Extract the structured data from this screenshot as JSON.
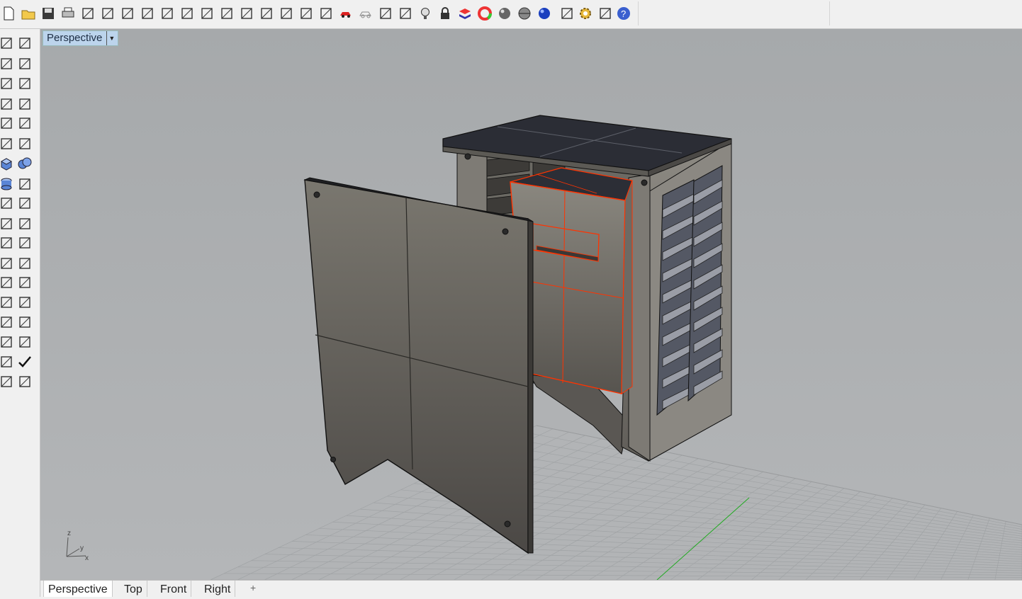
{
  "toolbar": {
    "icons": [
      "new-file-icon",
      "open-folder-icon",
      "save-icon",
      "print-icon",
      "import-icon",
      "cut-icon",
      "copy-icon",
      "paste-icon",
      "undo-icon",
      "pan-hand-icon",
      "rotate-view-icon",
      "zoom-icon",
      "zoom-window-icon",
      "zoom-extents-icon",
      "zoom-selected-icon",
      "rotate-camera-icon",
      "four-viewports-icon",
      "car-shade-icon",
      "car-wireframe-icon",
      "circle-target-icon",
      "snap-grid-icon",
      "light-bulb-icon",
      "lock-icon",
      "layer-icon",
      "color-wheel-icon",
      "sphere-gray-icon",
      "sphere-rendered-icon",
      "sphere-blue-icon",
      "pen-icon",
      "settings-gear-icon",
      "dimension-icon",
      "help-icon"
    ]
  },
  "sidebar": {
    "icons": [
      "select-arrow-icon",
      "point-icon",
      "polyline-icon",
      "curve-icon",
      "circle-icon",
      "ellipse-icon",
      "arc-icon",
      "rectangle-icon",
      "polygon-icon",
      "fillet-curve-icon",
      "surface-icon",
      "surface-edit-icon",
      "box-icon",
      "boolean-spheres-icon",
      "cylinder-icon",
      "mesh-plane-icon",
      "explode-gear-icon",
      "trim-icon",
      "split-icon",
      "join-icon",
      "group-icon",
      "ungroup-icon",
      "offset-icon",
      "blend-icon",
      "text-icon",
      "scale-icon",
      "array-icon",
      "mirror-icon",
      "extrude-box-icon",
      "align-icon",
      "grid-array-icon",
      "distribute-icon",
      "flow-icon",
      "check-icon",
      "analyze-icon",
      "render-icon"
    ]
  },
  "viewport": {
    "title": "Perspective",
    "axes": {
      "z": "z",
      "y": "y",
      "x": "x"
    }
  },
  "tabs": {
    "items": [
      "Perspective",
      "Top",
      "Front",
      "Right"
    ],
    "active": "Perspective",
    "add_label": "+"
  }
}
